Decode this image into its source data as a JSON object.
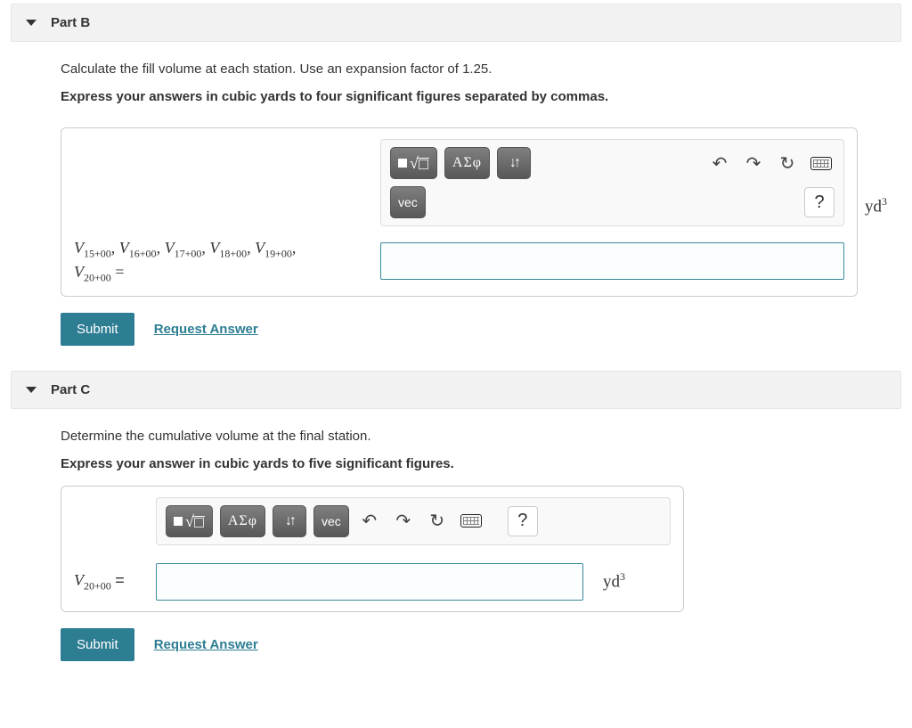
{
  "partB": {
    "title": "Part B",
    "prompt1": "Calculate the fill volume at each station. Use an expansion factor of 1.25.",
    "prompt2": "Express your answers in cubic yards to four significant figures separated by commas.",
    "var_label_html": "V15+00, V16+00, V17+00, V18+00, V19+00, V20+00 =",
    "unit": "yd³",
    "toolbar": {
      "template": "template",
      "root": "root",
      "greek": "ΑΣφ",
      "updown": "↓↑",
      "vec": "vec",
      "undo": "↶",
      "redo": "↷",
      "reset": "↻",
      "keyboard": "keyboard",
      "help": "?"
    },
    "submit": "Submit",
    "request": "Request Answer"
  },
  "partC": {
    "title": "Part C",
    "prompt1": "Determine the cumulative volume at the final station.",
    "prompt2": "Express your answer in cubic yards to five significant figures.",
    "var_label": "V20+00 =",
    "unit": "yd³",
    "toolbar": {
      "template": "template",
      "root": "root",
      "greek": "ΑΣφ",
      "updown": "↓↑",
      "vec": "vec",
      "undo": "↶",
      "redo": "↷",
      "reset": "↻",
      "keyboard": "keyboard",
      "help": "?"
    },
    "submit": "Submit",
    "request": "Request Answer"
  }
}
